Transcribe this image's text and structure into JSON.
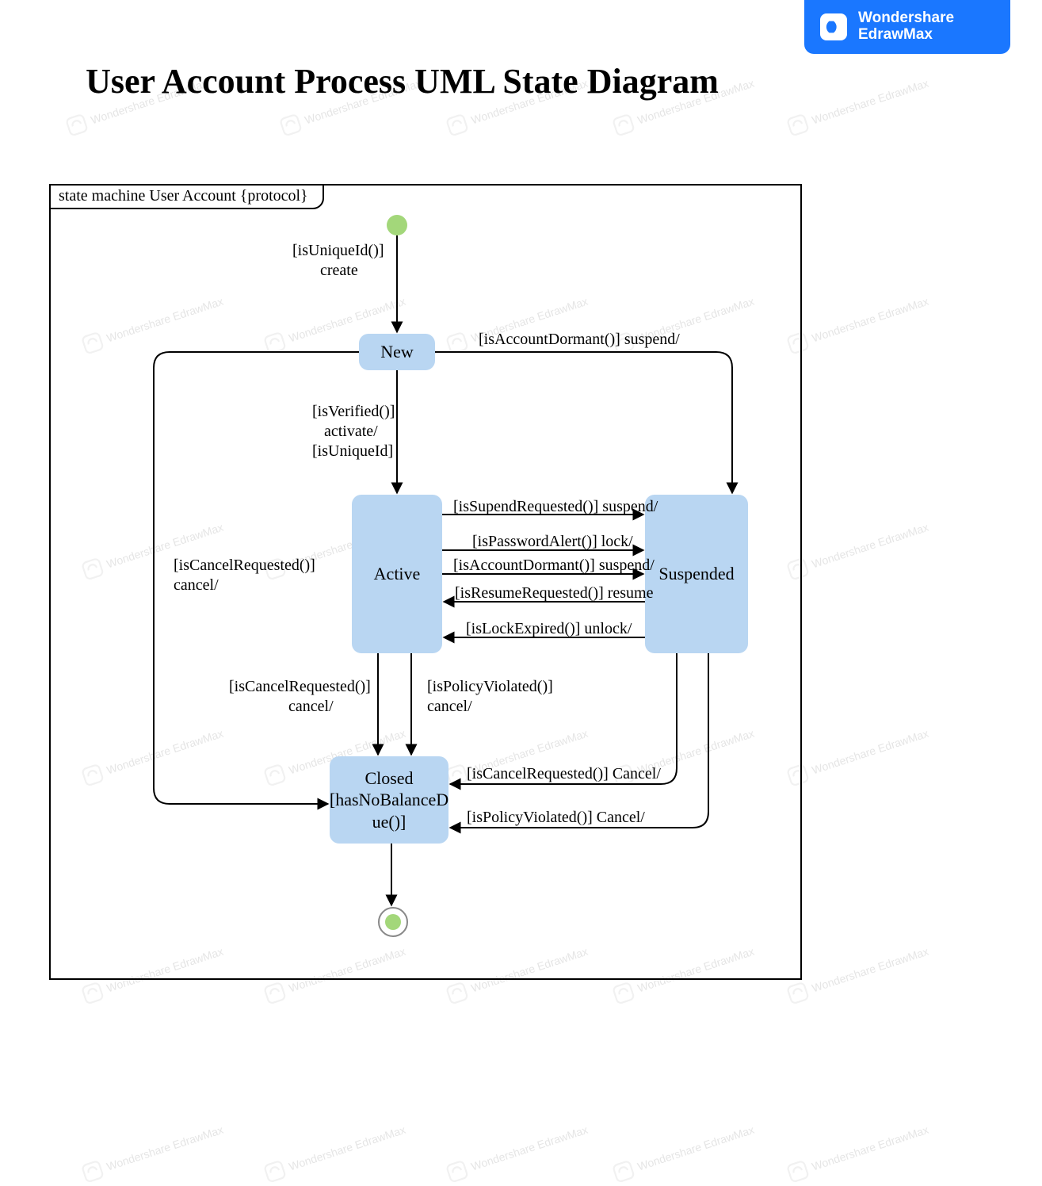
{
  "badge": {
    "brand_line1": "Wondershare",
    "brand_line2": "EdrawMax"
  },
  "title": "User Account Process UML State\nDiagram",
  "frame_tab": "state machine User Account {protocol}",
  "states": {
    "new": "New",
    "active": "Active",
    "suspended": "Suspended",
    "closed": "Closed\n[hasNoBalanceD\nue()]"
  },
  "transitions": {
    "init_to_new": "[isUniqueId()]\n       create",
    "new_to_active": "[isVerified()]\n   activate/\n[isUniqueId]",
    "new_to_suspended": "[isAccountDormant()] suspend/",
    "active_to_suspended_1": "[isSupendRequested()] suspend/",
    "active_to_suspended_2": "[isPasswordAlert()] lock/",
    "active_to_suspended_3": "[isAccountDormant()] suspend/",
    "suspended_to_active_1": "[isResumeRequested()] resume",
    "suspended_to_active_2": "[isLockExpired()] unlock/",
    "left_cancel": "[isCancelRequested()]\ncancel/",
    "active_to_closed_left": "[isCancelRequested()]\n               cancel/",
    "active_to_closed_right": "[isPolicyViolated()]\ncancel/",
    "suspended_to_closed_1": "[isCancelRequested()] Cancel/",
    "suspended_to_closed_2": "[isPolicyViolated()] Cancel/"
  },
  "watermark": "Wondershare\nEdrawMax"
}
